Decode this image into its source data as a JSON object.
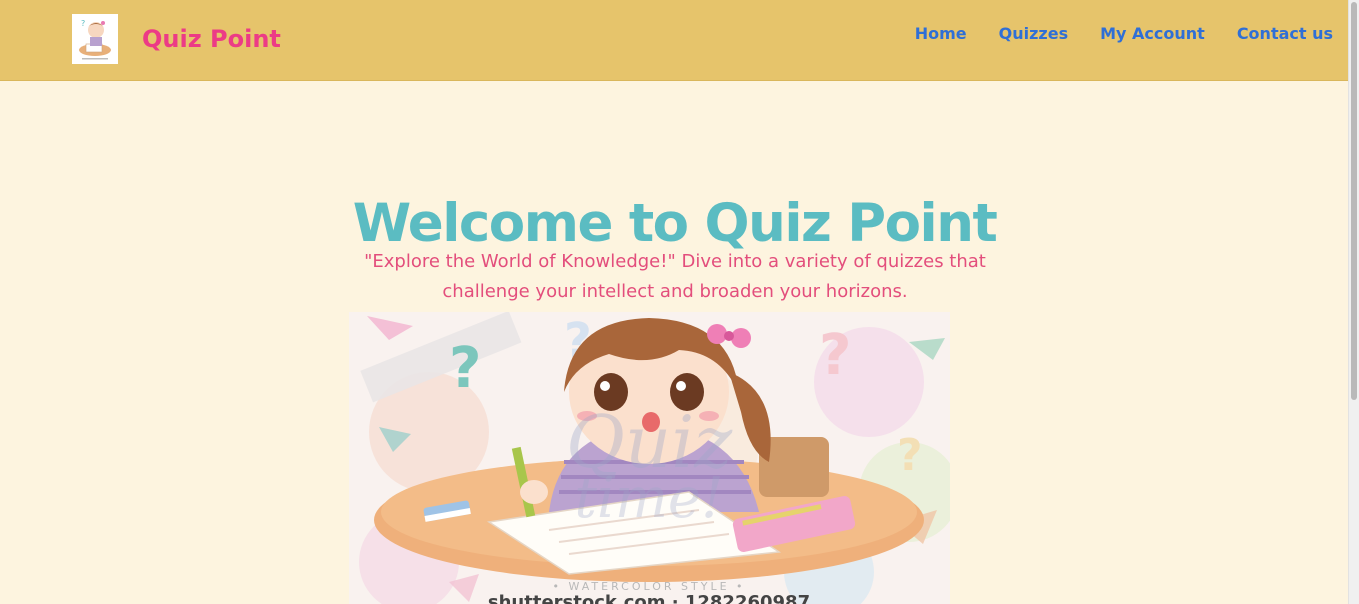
{
  "header": {
    "brand": "Quiz Point",
    "nav": [
      {
        "label": "Home"
      },
      {
        "label": "Quizzes"
      },
      {
        "label": "My Account"
      },
      {
        "label": "Contact us"
      }
    ]
  },
  "hero": {
    "title": "Welcome to Quiz Point",
    "subtitle": "\"Explore the World of Knowledge!\" Dive into a variety of quizzes that challenge your intellect and broaden your horizons.",
    "image": {
      "icon": "girl-studying-illustration",
      "watermark_style": "• WATERCOLOR STYLE •",
      "watermark_stock": "shutterstock.com · 1282260987"
    }
  },
  "colors": {
    "navbar": "#e6c46b",
    "background": "#fdf4df",
    "brand": "#ec3b86",
    "nav_link": "#2f6fd6",
    "title": "#5bbcc2",
    "subtitle": "#e34e7c"
  }
}
